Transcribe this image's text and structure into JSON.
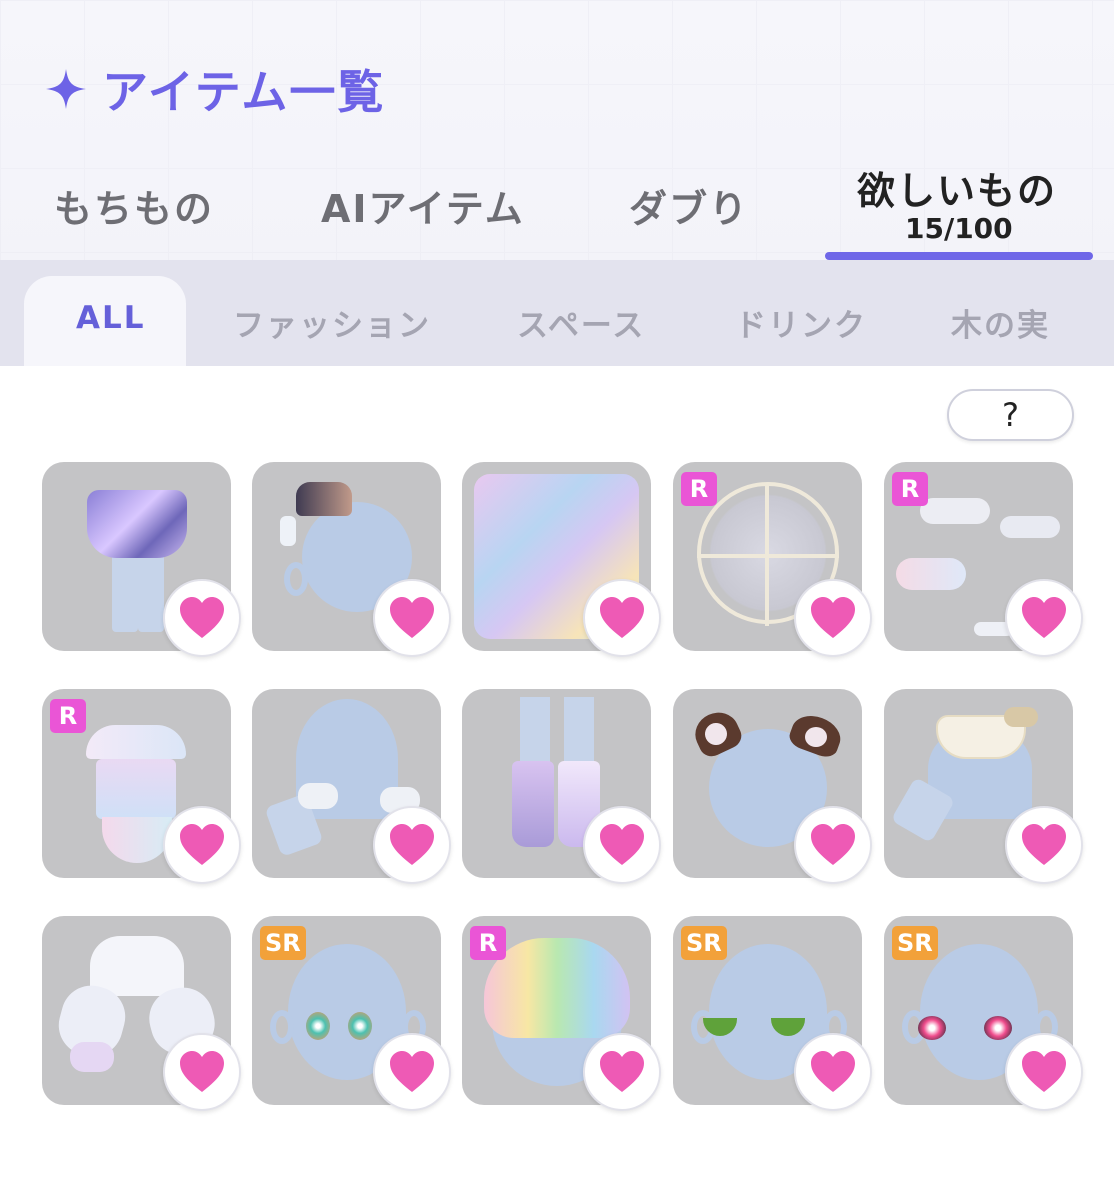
{
  "header": {
    "title": "アイテム一覧",
    "accent_color": "#6d63e6",
    "sparkle_icon": "sparkle-icon"
  },
  "main_tabs": [
    {
      "label": "もちもの",
      "active": false
    },
    {
      "label": "AIアイテム",
      "active": false
    },
    {
      "label": "ダブり",
      "active": false
    },
    {
      "label": "欲しいもの",
      "active": true,
      "count": "15/100"
    }
  ],
  "category_tabs": [
    {
      "label": "ALL",
      "active": true
    },
    {
      "label": "ファッション",
      "active": false
    },
    {
      "label": "スペース",
      "active": false
    },
    {
      "label": "ドリンク",
      "active": false
    },
    {
      "label": "木の実",
      "active": false
    }
  ],
  "help_button": {
    "label": "?"
  },
  "items": [
    {
      "name": "holographic-skirt",
      "rarity": ""
    },
    {
      "name": "mini-hat-accessory",
      "rarity": ""
    },
    {
      "name": "pastel-wallpaper",
      "rarity": ""
    },
    {
      "name": "ferris-wheel",
      "rarity": "R"
    },
    {
      "name": "rainbow-clouds",
      "rarity": "R"
    },
    {
      "name": "merry-go-round",
      "rarity": "R"
    },
    {
      "name": "fluffy-wrist-cuffs",
      "rarity": ""
    },
    {
      "name": "lavender-boots",
      "rarity": ""
    },
    {
      "name": "brown-animal-ears",
      "rarity": ""
    },
    {
      "name": "frilled-collar-top",
      "rarity": ""
    },
    {
      "name": "white-puff-blouse",
      "rarity": ""
    },
    {
      "name": "sparkle-eyes",
      "rarity": "SR"
    },
    {
      "name": "rainbow-hair",
      "rarity": "R"
    },
    {
      "name": "green-eyes",
      "rarity": "SR"
    },
    {
      "name": "pink-lashes-eyes",
      "rarity": "SR"
    }
  ],
  "colors": {
    "heart": "#ee5ab5",
    "rarity_r": "#ea55d6",
    "rarity_sr": "#f2a13a",
    "card_bg": "#c4c4c6"
  }
}
